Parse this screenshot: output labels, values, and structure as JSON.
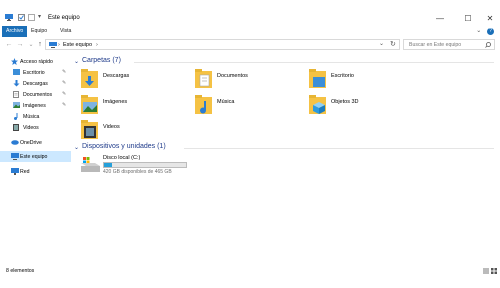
{
  "window": {
    "title": "Este equipo",
    "controls": {
      "minimize": "—",
      "maximize": "☐",
      "close": "✕"
    }
  },
  "ribbon": {
    "tabs": [
      {
        "label": "Archivo",
        "active": true
      },
      {
        "label": "Equipo",
        "active": false
      },
      {
        "label": "Vista",
        "active": false
      }
    ],
    "expand_icon": "chevron-down-icon",
    "help_icon": "help-icon"
  },
  "navigation": {
    "back": "←",
    "forward": "→",
    "recent": "⌄",
    "up": "↑",
    "address": {
      "path": "Este equipo",
      "separator": "›"
    },
    "address_dropdown": "⌄",
    "refresh": "↻",
    "search": {
      "placeholder": "Buscar en Este equipo"
    }
  },
  "sidebar": {
    "items": [
      {
        "label": "Acceso rápido",
        "icon": "star-icon",
        "pinned": false,
        "selected": false
      },
      {
        "label": "Escritorio",
        "icon": "desktop-folder-icon",
        "pinned": true,
        "selected": false
      },
      {
        "label": "Descargas",
        "icon": "download-icon",
        "pinned": true,
        "selected": false
      },
      {
        "label": "Documentos",
        "icon": "documents-icon",
        "pinned": true,
        "selected": false
      },
      {
        "label": "Imágenes",
        "icon": "pictures-icon",
        "pinned": true,
        "selected": false
      },
      {
        "label": "Música",
        "icon": "music-icon",
        "pinned": false,
        "selected": false
      },
      {
        "label": "Videos",
        "icon": "videos-icon",
        "pinned": false,
        "selected": false
      },
      {
        "label": "OneDrive",
        "icon": "cloud-icon",
        "pinned": false,
        "selected": false
      },
      {
        "label": "Este equipo",
        "icon": "computer-icon",
        "pinned": false,
        "selected": true
      },
      {
        "label": "Red",
        "icon": "network-icon",
        "pinned": false,
        "selected": false
      }
    ]
  },
  "content": {
    "folders_group": {
      "title": "Carpetas (7)",
      "items": [
        {
          "label": "Descargas",
          "icon": "downloads-folder-icon"
        },
        {
          "label": "Documentos",
          "icon": "documents-folder-icon"
        },
        {
          "label": "Escritorio",
          "icon": "desktop-folder-icon"
        },
        {
          "label": "Imágenes",
          "icon": "pictures-folder-icon"
        },
        {
          "label": "Música",
          "icon": "music-folder-icon"
        },
        {
          "label": "Objetos 3D",
          "icon": "3d-objects-folder-icon"
        },
        {
          "label": "Videos",
          "icon": "videos-folder-icon"
        }
      ]
    },
    "devices_group": {
      "title": "Dispositivos y unidades (1)",
      "drives": [
        {
          "name": "Disco local (C:)",
          "info": "420 GB disponibles de 465 GB",
          "used_fraction": 0.097
        }
      ]
    }
  },
  "status": {
    "count": "8 elementos",
    "view_icons": [
      "details-view-icon",
      "large-icons-view-icon"
    ]
  },
  "colors": {
    "accent": "#1a6fb8",
    "selection": "#cce8ff",
    "group_title": "#1e3a8a",
    "folder": "#f5c244",
    "drive_bar": "#26a0da"
  }
}
